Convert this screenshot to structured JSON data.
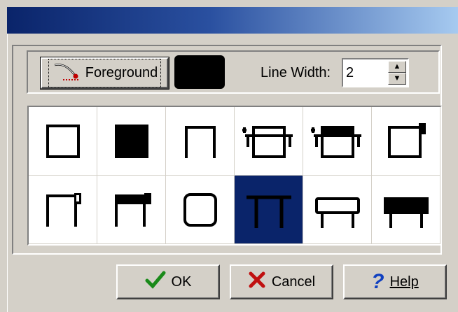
{
  "toolbar": {
    "foreground_label": "Foreground",
    "foreground_color": "#000000",
    "line_width_label": "Line Width:",
    "line_width_value": "2"
  },
  "styles": {
    "rows": 2,
    "columns": 6,
    "selected_index": 9,
    "selected_color": "#0a246a",
    "items": [
      "box",
      "filled-box",
      "open-bottom-box",
      "box-with-top-rail",
      "box-with-filled-top-rail",
      "box-with-corner-tab",
      "open-box-with-corner-tab",
      "open-box-with-filled-top-corner",
      "rounded-box",
      "table-shape",
      "table-with-box-top",
      "table-with-filled-top"
    ]
  },
  "buttons": {
    "ok_label": "OK",
    "cancel_label": "Cancel",
    "help_label": "Help"
  },
  "colors": {
    "titlebar_start": "#0a246a",
    "titlebar_end": "#a6caf0",
    "face": "#d4d0c8"
  }
}
